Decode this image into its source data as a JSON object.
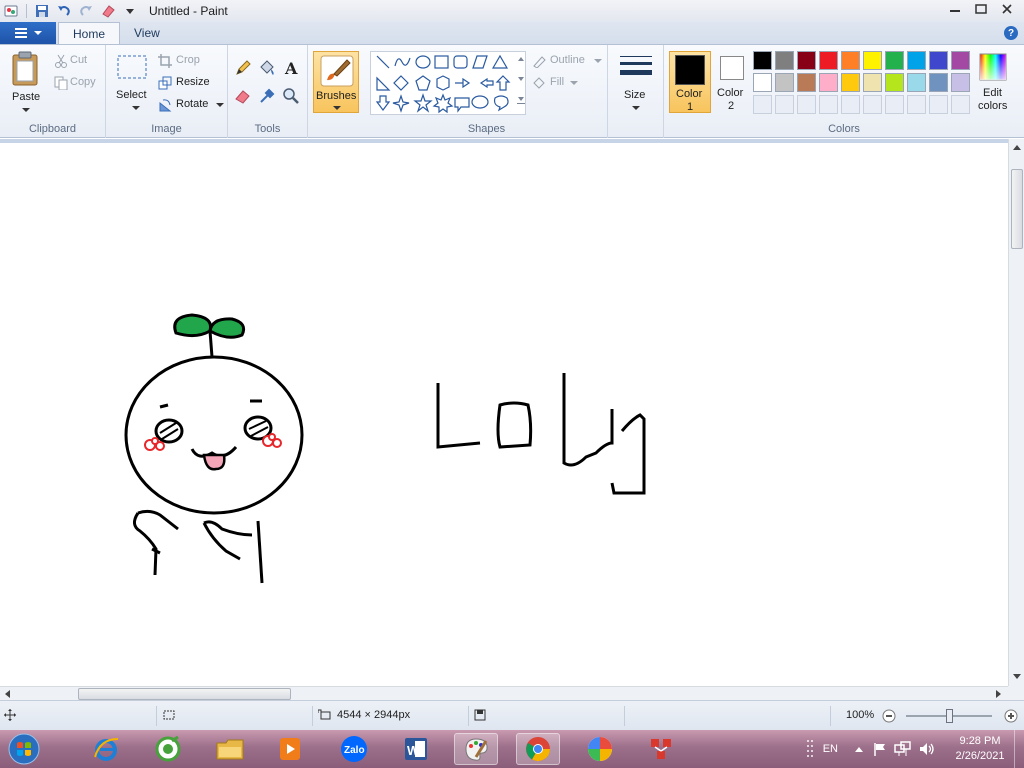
{
  "window": {
    "title": "Untitled - Paint"
  },
  "tabs": [
    {
      "label": "Home"
    },
    {
      "label": "View"
    }
  ],
  "ribbon": {
    "clipboard": {
      "paste": "Paste",
      "cut": "Cut",
      "copy": "Copy",
      "label": "Clipboard"
    },
    "image": {
      "select": "Select",
      "crop": "Crop",
      "resize": "Resize",
      "rotate": "Rotate",
      "label": "Image"
    },
    "tools": {
      "label": "Tools"
    },
    "brushes": {
      "label": "Brushes"
    },
    "shapes": {
      "outline": "Outline",
      "fill": "Fill",
      "label": "Shapes"
    },
    "size": {
      "label": "Size"
    },
    "colors": {
      "color1_label": "Color",
      "color1_num": "1",
      "color2_label": "Color",
      "color2_num": "2",
      "edit_colors_line1": "Edit",
      "edit_colors_line2": "colors",
      "label": "Colors",
      "color1": "#000000",
      "color2": "#ffffff",
      "palette_row1": [
        "#000000",
        "#7f7f7f",
        "#880015",
        "#ed1c24",
        "#ff7f27",
        "#fff200",
        "#22b14c",
        "#00a2e8",
        "#3f48cc",
        "#a349a4"
      ],
      "palette_row2": [
        "#ffffff",
        "#c3c3c3",
        "#b97a57",
        "#ffaec9",
        "#ffc90e",
        "#efe4b0",
        "#b5e61d",
        "#99d9ea",
        "#7092be",
        "#c8bfe7"
      ]
    }
  },
  "canvas": {
    "drawing_text": "Loly",
    "sprout_color": "#22a64c",
    "cheek_color": "#e8262b",
    "tongue_color": "#f4a6b8"
  },
  "status": {
    "image_size": "4544 × 2944px",
    "zoom": "100%"
  },
  "taskbar": {
    "apps": [
      "start-orb",
      "internet-explorer",
      "cococ-browser",
      "file-explorer",
      "media-player",
      "zalo",
      "word",
      "paint",
      "chrome",
      "color-app",
      "network-app"
    ],
    "language": "EN",
    "time": "9:28 PM",
    "date": "2/26/2021"
  }
}
